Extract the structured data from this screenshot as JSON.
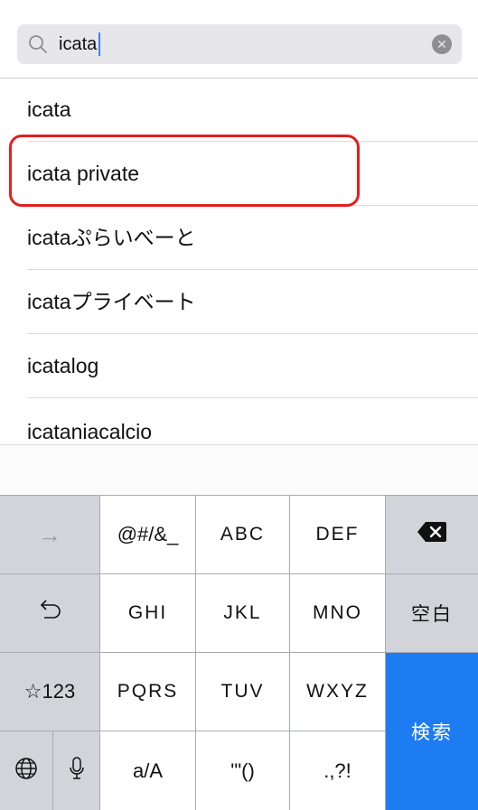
{
  "search": {
    "query": "icata"
  },
  "suggestions": [
    "icata",
    "icata private",
    "icataぷらいべーと",
    "icataプライベート",
    "icatalog",
    "icataniacalcio"
  ],
  "keyboard": {
    "row1": {
      "arrow": "→",
      "k1": "@#/&_",
      "k2": "ABC",
      "k3": "DEF",
      "delete_icon": "backspace-icon"
    },
    "row2": {
      "undo": "↺",
      "k1": "GHI",
      "k2": "JKL",
      "k3": "MNO",
      "space": "空白"
    },
    "row3": {
      "mode": "☆123",
      "k1": "PQRS",
      "k2": "TUV",
      "k3": "WXYZ",
      "search": "検索"
    },
    "row4": {
      "globe_icon": "globe-icon",
      "mic_icon": "microphone-icon",
      "k1": "a/A",
      "k2": "'\"()",
      "k3": ".,?!"
    }
  },
  "colors": {
    "accent": "#1e7cf2",
    "highlight": "#e02020"
  }
}
